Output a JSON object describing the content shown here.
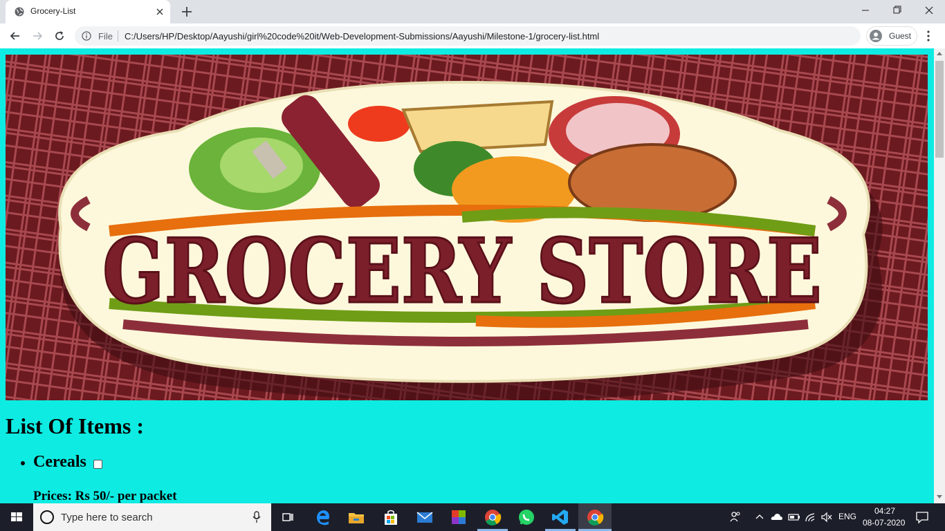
{
  "browser": {
    "tab_title": "Grocery-List",
    "omnibox_scheme": "File",
    "url": "C:/Users/HP/Desktop/Aayushi/girl%20code%20it/Web-Development-Submissions/Aayushi/Milestone-1/grocery-list.html",
    "profile_label": "Guest"
  },
  "page": {
    "banner_alt": "GROCERY STORE",
    "list_heading": "List Of Items :",
    "items": [
      {
        "name": "Cereals",
        "checked": false,
        "price": "Prices: Rs 50/- per packet"
      }
    ],
    "background_color": "#0eebe2"
  },
  "taskbar": {
    "search_placeholder": "Type here to search",
    "language": "ENG",
    "time": "04:27",
    "date": "08-07-2020",
    "icons": [
      "windows-icon",
      "cortana-icon",
      "mic-icon",
      "task-view-icon",
      "edge-icon",
      "file-explorer-icon",
      "store-icon",
      "mail-icon",
      "office-icon",
      "chrome-icon",
      "whatsapp-icon",
      "vscode-icon",
      "chrome-icon"
    ]
  }
}
